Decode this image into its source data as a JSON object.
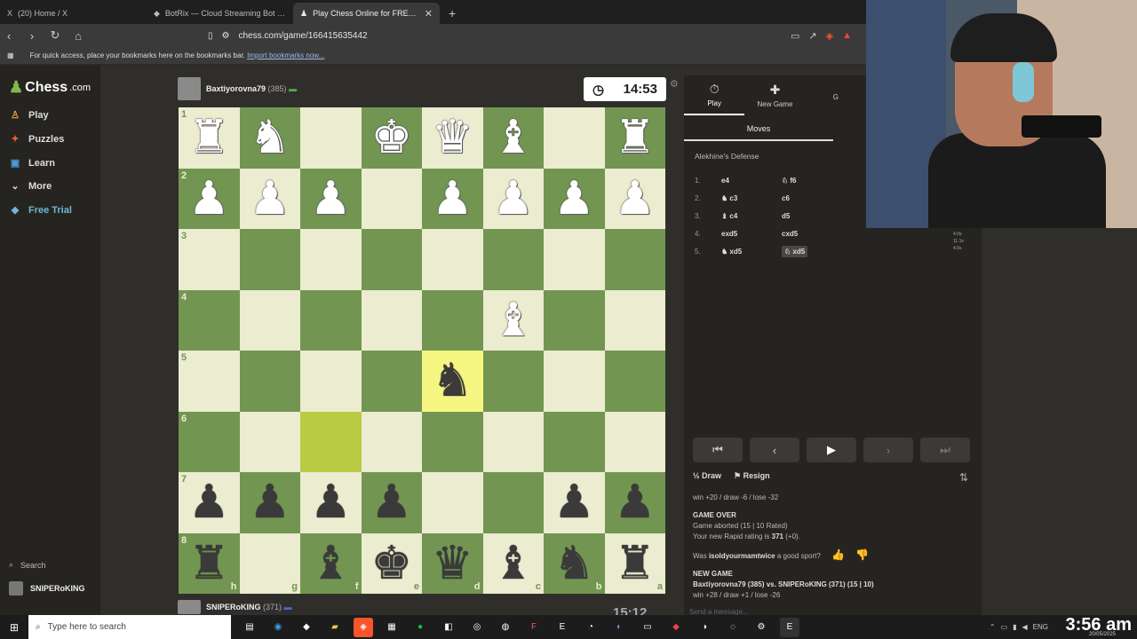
{
  "browser": {
    "tabs": [
      {
        "label": "(20) Home / X",
        "icon": "X",
        "active": false
      },
      {
        "label": "BotRix — Cloud Streaming Bot for Tw",
        "icon": "◆",
        "active": false
      },
      {
        "label": "Play Chess Online for FREE - 2 Pl",
        "icon": "♟",
        "active": true
      }
    ],
    "new_tab": "+",
    "url": "chess.com/game/166415635442",
    "bookmarks_text": "For quick access, place your bookmarks here on the bookmarks bar.",
    "bookmarks_link": "Import bookmarks now..."
  },
  "sidebar": {
    "logo_main": "Chess",
    "logo_suffix": ".com",
    "items": [
      {
        "label": "Play",
        "icon": "♙",
        "color": "#e8a33d"
      },
      {
        "label": "Puzzles",
        "icon": "✦",
        "color": "#e2613a"
      },
      {
        "label": "Learn",
        "icon": "▣",
        "color": "#4e9bd8"
      },
      {
        "label": "More",
        "icon": "⌄",
        "color": "#bbb"
      },
      {
        "label": "Free Trial",
        "icon": "◆",
        "color": "#6fb6d6"
      }
    ],
    "search_label": "Search",
    "user_label": "SNIPERoKING"
  },
  "game": {
    "top_player": {
      "name": "Baxtiyorovna79",
      "rating": "(385)"
    },
    "bottom_player": {
      "name": "SNIPERoKING",
      "rating": "(371)"
    },
    "top_clock": "14:53",
    "bottom_clock": "15:12",
    "board": [
      [
        "wr",
        "wn",
        "",
        "wk",
        "wq",
        "wb",
        "",
        "wr"
      ],
      [
        "wp",
        "wp",
        "wp",
        "",
        "wp",
        "wp",
        "wp",
        "wp"
      ],
      [
        "",
        "",
        "",
        "",
        "",
        "",
        "",
        ""
      ],
      [
        "",
        "",
        "",
        "",
        "",
        "wb",
        "",
        ""
      ],
      [
        "",
        "",
        "",
        "",
        "bn",
        "",
        "",
        ""
      ],
      [
        "",
        "",
        "hl",
        "",
        "",
        "",
        "",
        ""
      ],
      [
        "bp",
        "bp",
        "bp",
        "bp",
        "",
        "",
        "bp",
        "bp"
      ],
      [
        "br",
        "",
        "bb",
        "bk",
        "bq",
        "bb",
        "bn",
        "br"
      ]
    ],
    "highlight_squares": [
      [
        4,
        4
      ],
      [
        5,
        2
      ]
    ],
    "ranks": [
      "1",
      "2",
      "3",
      "4",
      "5",
      "6",
      "7",
      "8"
    ],
    "files": [
      "h",
      "g",
      "f",
      "e",
      "d",
      "c",
      "b",
      "a"
    ]
  },
  "panel": {
    "tabs": [
      {
        "label": "Play",
        "icon": "⏱"
      },
      {
        "label": "New Game",
        "icon": "✚"
      },
      {
        "label": "G",
        "icon": ""
      }
    ],
    "moves_header": "Moves",
    "opening": "Alekhine's Defense",
    "moves": [
      {
        "n": "1.",
        "w": "e4",
        "b": "♘ f6"
      },
      {
        "n": "2.",
        "w": "♞ c3",
        "b": "c6"
      },
      {
        "n": "3.",
        "w": "♝ c4",
        "b": "d5"
      },
      {
        "n": "4.",
        "w": "exd5",
        "b": "cxd5"
      },
      {
        "n": "5.",
        "w": "♞ xd5",
        "b": "♘ xd5"
      }
    ],
    "controls": [
      "⏮",
      "‹",
      "▶",
      "›",
      "⏭"
    ],
    "draw_label": "Draw",
    "draw_icon": "½",
    "resign_label": "Resign",
    "resign_icon": "⚑",
    "chat": {
      "line1": "win +20 / draw -6 / lose -32",
      "game_over": "GAME OVER",
      "aborted": "Game aborted (15 | 10 Rated)",
      "rating_prefix": "Your new Rapid rating is",
      "rating_value": "371",
      "rating_suffix": "(+0).",
      "sport_prefix": "Was",
      "sport_user": "isoldyourmamtwice",
      "sport_suffix": "a good sport?",
      "new_game": "NEW GAME",
      "match": "Baxtiyorovna79 (385) vs. SNIPERoKING (371) (15 | 10)",
      "odds": "win +28 / draw +1 / lose -26",
      "input_placeholder": "Send a message..."
    }
  },
  "side_times": [
    "4.0s",
    "11.1s",
    "4.0s"
  ],
  "taskbar": {
    "search_placeholder": "Type here to search",
    "clock": "3:56 am",
    "date": "20/05/2025",
    "lang": "ENG"
  }
}
